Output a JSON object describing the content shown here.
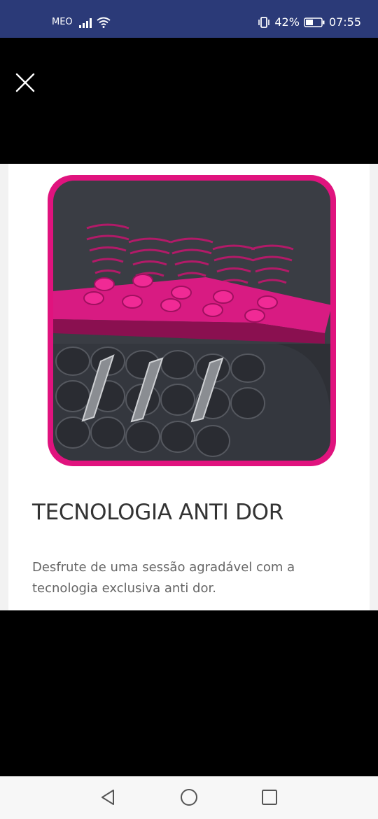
{
  "status_bar": {
    "carrier": "MEO",
    "battery_percent": "42%",
    "time": "07:55"
  },
  "icons": {
    "signal": "signal-icon",
    "wifi": "wifi-icon",
    "vibrate": "vibrate-icon",
    "battery": "battery-icon",
    "close": "close-icon",
    "back": "back-icon",
    "home": "home-icon",
    "recents": "recents-icon"
  },
  "feature": {
    "title": "TECNOLOGIA ANTI DOR",
    "description": "Desfrute de uma sessão agradável com a tecnologia exclusiva anti dor."
  },
  "colors": {
    "status_bar": "#2b3a78",
    "accent": "#e0137e",
    "illustration_dark": "#3a3d44"
  }
}
